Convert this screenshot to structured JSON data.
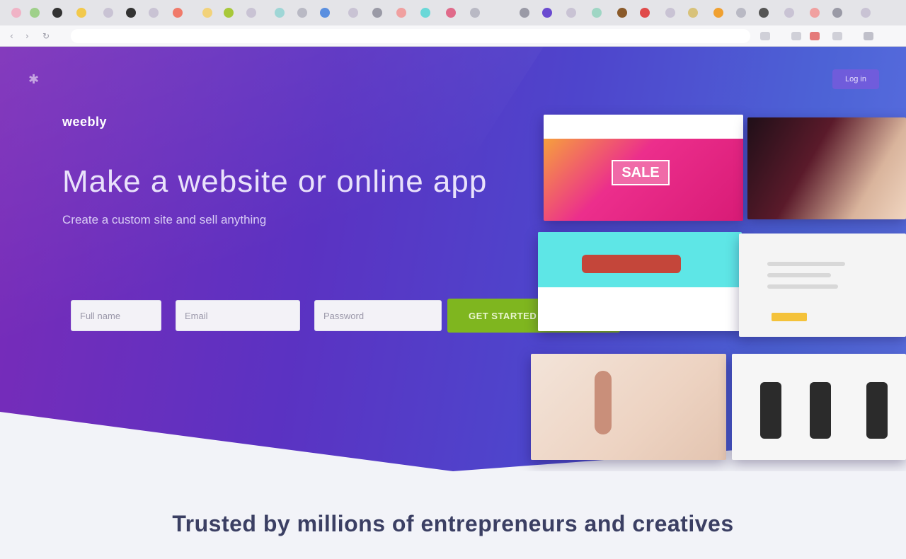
{
  "browser": {
    "address": "",
    "colors": {
      "tab_strip": "#e4e4e8",
      "toolbar": "#f7f7f9"
    }
  },
  "hero": {
    "logo": "weebly",
    "headline": "Make a website or online app",
    "subhead": "Create a custom site and sell anything",
    "signup": {
      "name_placeholder": "Full name",
      "email_placeholder": "Email",
      "password_placeholder": "Password",
      "cta_label": "GET STARTED — IT'S FREE"
    },
    "login_label": "Log in",
    "menu_icon": "menu-icon",
    "colors": {
      "gradient_start": "#7a2bb8",
      "gradient_end": "#5a6fe0",
      "cta": "#7fb61f"
    }
  },
  "templates": [
    {
      "name": "template-1",
      "label": "SALE"
    },
    {
      "name": "template-2"
    },
    {
      "name": "template-3"
    },
    {
      "name": "template-4"
    },
    {
      "name": "template-5"
    },
    {
      "name": "template-6"
    }
  ],
  "trusted": {
    "title": "Trusted by millions of entrepreneurs and creatives"
  }
}
